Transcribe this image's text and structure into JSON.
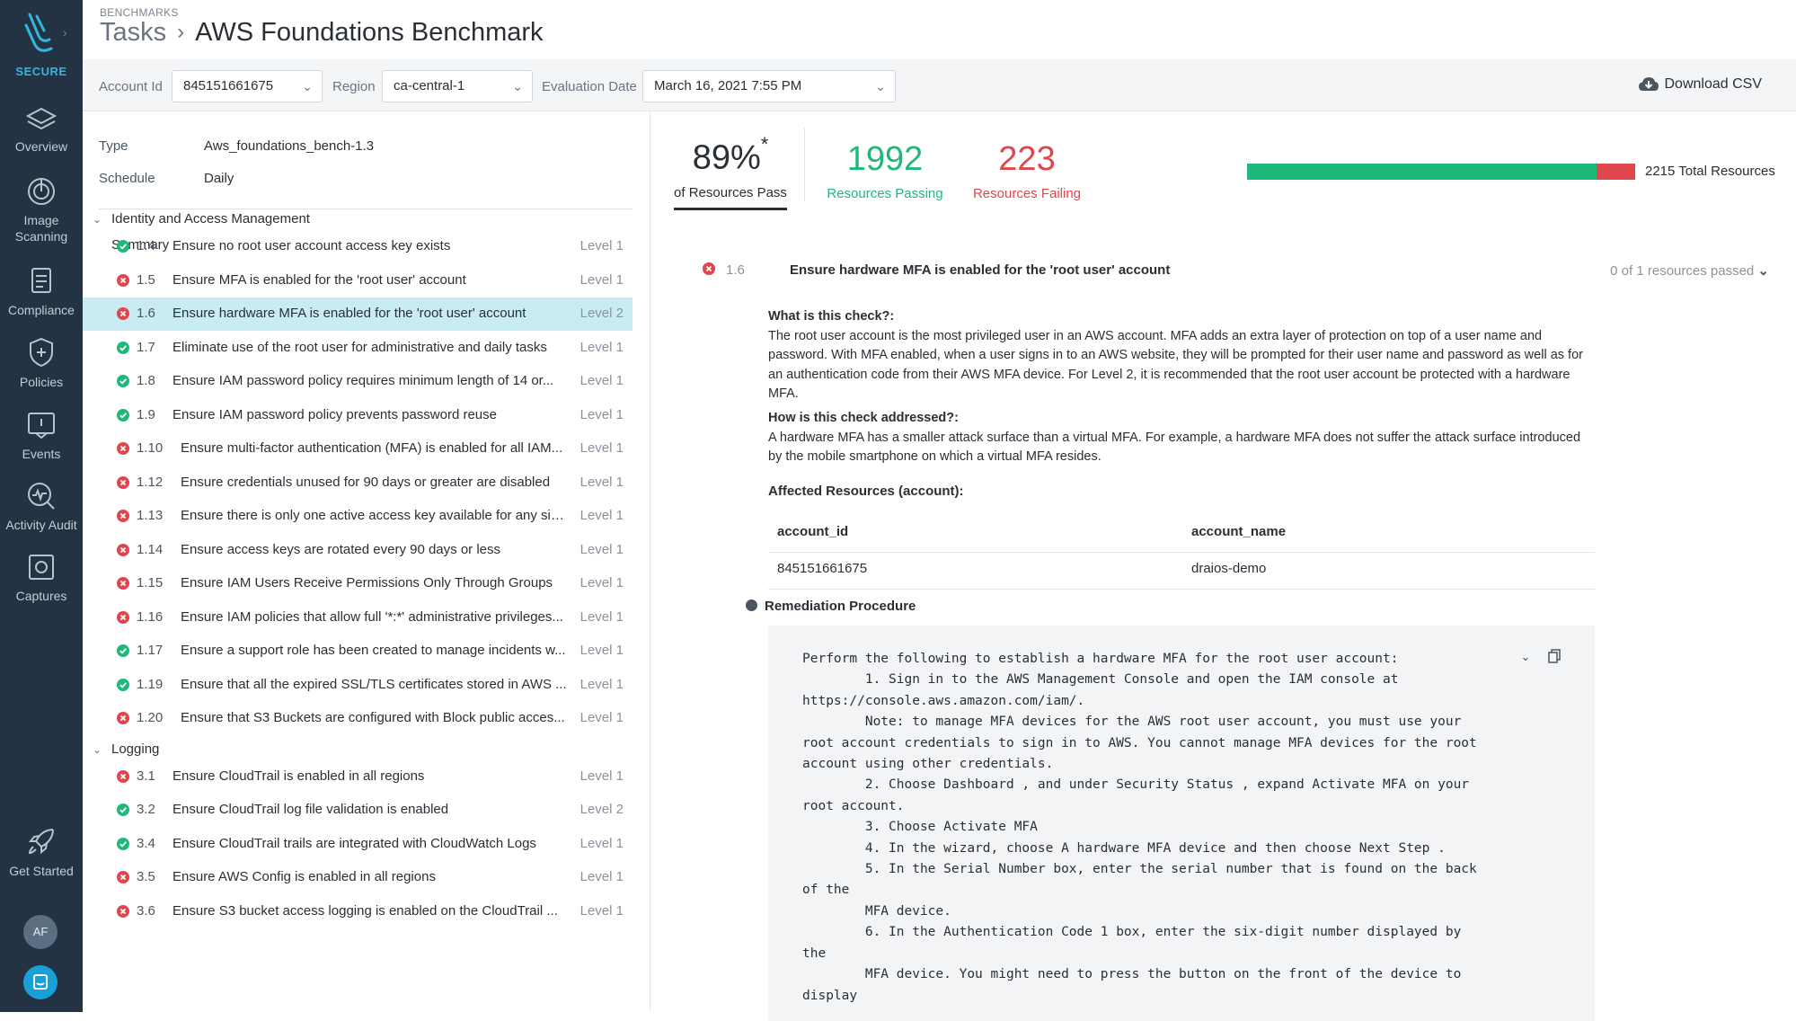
{
  "sidebar": {
    "brand": "SECURE",
    "items": [
      {
        "label": "Overview",
        "icon": "layers-icon"
      },
      {
        "label": "Image Scanning",
        "icon": "scan-icon"
      },
      {
        "label": "Compliance",
        "icon": "clipboard-icon"
      },
      {
        "label": "Policies",
        "icon": "shield-icon"
      },
      {
        "label": "Events",
        "icon": "events-icon"
      },
      {
        "label": "Activity Audit",
        "icon": "activity-icon"
      },
      {
        "label": "Captures",
        "icon": "capture-icon"
      }
    ],
    "get_started": "Get Started",
    "avatar": "AF"
  },
  "header": {
    "section": "BENCHMARKS",
    "crumb": "Tasks",
    "title": "AWS Foundations Benchmark"
  },
  "filters": {
    "account_label": "Account Id",
    "account_value": "845151661675",
    "region_label": "Region",
    "region_value": "ca-central-1",
    "date_label": "Evaluation Date",
    "date_value": "March 16, 2021 7:55 PM",
    "download": "Download CSV"
  },
  "meta": {
    "type_label": "Type",
    "type_value": "Aws_foundations_bench-1.3",
    "schedule_label": "Schedule",
    "schedule_value": "Daily"
  },
  "summary": "Summary",
  "sections": [
    {
      "name": "Identity and Access Management",
      "checks": [
        {
          "status": "pass",
          "num": "1.4",
          "title": "Ensure no root user account access key exists",
          "level": "Level 1"
        },
        {
          "status": "fail",
          "num": "1.5",
          "title": "Ensure MFA is enabled for the 'root user' account",
          "level": "Level 1"
        },
        {
          "status": "fail",
          "num": "1.6",
          "title": "Ensure hardware MFA is enabled for the 'root user' account",
          "level": "Level 2",
          "selected": true
        },
        {
          "status": "pass",
          "num": "1.7",
          "title": "Eliminate use of the root user for administrative and daily tasks",
          "level": "Level 1"
        },
        {
          "status": "pass",
          "num": "1.8",
          "title": "Ensure IAM password policy requires minimum length of 14 or...",
          "level": "Level 1"
        },
        {
          "status": "pass",
          "num": "1.9",
          "title": "Ensure IAM password policy prevents password reuse",
          "level": "Level 1"
        },
        {
          "status": "fail",
          "num": "1.10",
          "title": "Ensure multi-factor authentication (MFA) is enabled for all IAM...",
          "level": "Level 1"
        },
        {
          "status": "fail",
          "num": "1.12",
          "title": "Ensure credentials unused for 90 days or greater are disabled",
          "level": "Level 1"
        },
        {
          "status": "fail",
          "num": "1.13",
          "title": "Ensure there is only one active access key available for any sin...",
          "level": "Level 1"
        },
        {
          "status": "fail",
          "num": "1.14",
          "title": "Ensure access keys are rotated every 90 days or less",
          "level": "Level 1"
        },
        {
          "status": "fail",
          "num": "1.15",
          "title": "Ensure IAM Users Receive Permissions Only Through Groups",
          "level": "Level 1"
        },
        {
          "status": "fail",
          "num": "1.16",
          "title": "Ensure IAM policies that allow full '*:*' administrative privileges...",
          "level": "Level 1"
        },
        {
          "status": "pass",
          "num": "1.17",
          "title": "Ensure a support role has been created to manage incidents w...",
          "level": "Level 1"
        },
        {
          "status": "pass",
          "num": "1.19",
          "title": "Ensure that all the expired SSL/TLS certificates stored in AWS ...",
          "level": "Level 1"
        },
        {
          "status": "fail",
          "num": "1.20",
          "title": "Ensure that S3 Buckets are configured with Block public acces...",
          "level": "Level 1"
        }
      ]
    },
    {
      "name": "Logging",
      "checks": [
        {
          "status": "fail",
          "num": "3.1",
          "title": "Ensure CloudTrail is enabled in all regions",
          "level": "Level 1"
        },
        {
          "status": "pass",
          "num": "3.2",
          "title": "Ensure CloudTrail log file validation is enabled",
          "level": "Level 2"
        },
        {
          "status": "pass",
          "num": "3.4",
          "title": "Ensure CloudTrail trails are integrated with CloudWatch Logs",
          "level": "Level 1"
        },
        {
          "status": "fail",
          "num": "3.5",
          "title": "Ensure AWS Config is enabled in all regions",
          "level": "Level 1"
        },
        {
          "status": "fail",
          "num": "3.6",
          "title": "Ensure S3 bucket access logging is enabled on the CloudTrail ...",
          "level": "Level 1"
        }
      ]
    }
  ],
  "stats": {
    "pass_percent": "89%",
    "pass_percent_mark": "*",
    "pass_percent_label": "of Resources Pass",
    "passing": "1992",
    "passing_label": "Resources Passing",
    "failing": "223",
    "failing_label": "Resources Failing",
    "total": "2215 Total Resources",
    "fail_fraction": 0.1007,
    "pass_color": "#1fb87a",
    "fail_color": "#e0464d"
  },
  "detail": {
    "num": "1.6",
    "title": "Ensure hardware MFA is enabled for the 'root user' account",
    "resources_passed": "0 of 1 resources passed",
    "what_q": "What is this check?:",
    "what_a": "The root user account is the most privileged user in an AWS account. MFA adds an extra layer of protection on top of a user name and password. With MFA enabled, when a user signs in to an AWS website, they will be prompted for their user name and password as well as for an authentication code from their AWS MFA device. For Level 2, it is recommended that the root user account be protected with a hardware MFA.",
    "how_q": "How is this check addressed?:",
    "how_a": "A hardware MFA has a smaller attack surface than a virtual MFA. For example, a hardware MFA does not suffer the attack surface introduced by the mobile smartphone on which a virtual MFA resides.",
    "affected_title": "Affected Resources (account):",
    "col1": "account_id",
    "col2": "account_name",
    "val1": "845151661675",
    "val2": "draios-demo",
    "remediation_title": "Remediation Procedure",
    "remediation_code": "Perform the following to establish a hardware MFA for the root user account:\n        1. Sign in to the AWS Management Console and open the IAM console at\nhttps://console.aws.amazon.com/iam/.\n        Note: to manage MFA devices for the AWS root user account, you must use your\nroot account credentials to sign in to AWS. You cannot manage MFA devices for the root\naccount using other credentials.\n        2. Choose Dashboard , and under Security Status , expand Activate MFA on your\nroot account.\n        3. Choose Activate MFA\n        4. In the wizard, choose A hardware MFA device and then choose Next Step .\n        5. In the Serial Number box, enter the serial number that is found on the back\nof the\n        MFA device.\n        6. In the Authentication Code 1 box, enter the six-digit number displayed by\nthe\n        MFA device. You might need to press the button on the front of the device to\ndisplay"
  }
}
